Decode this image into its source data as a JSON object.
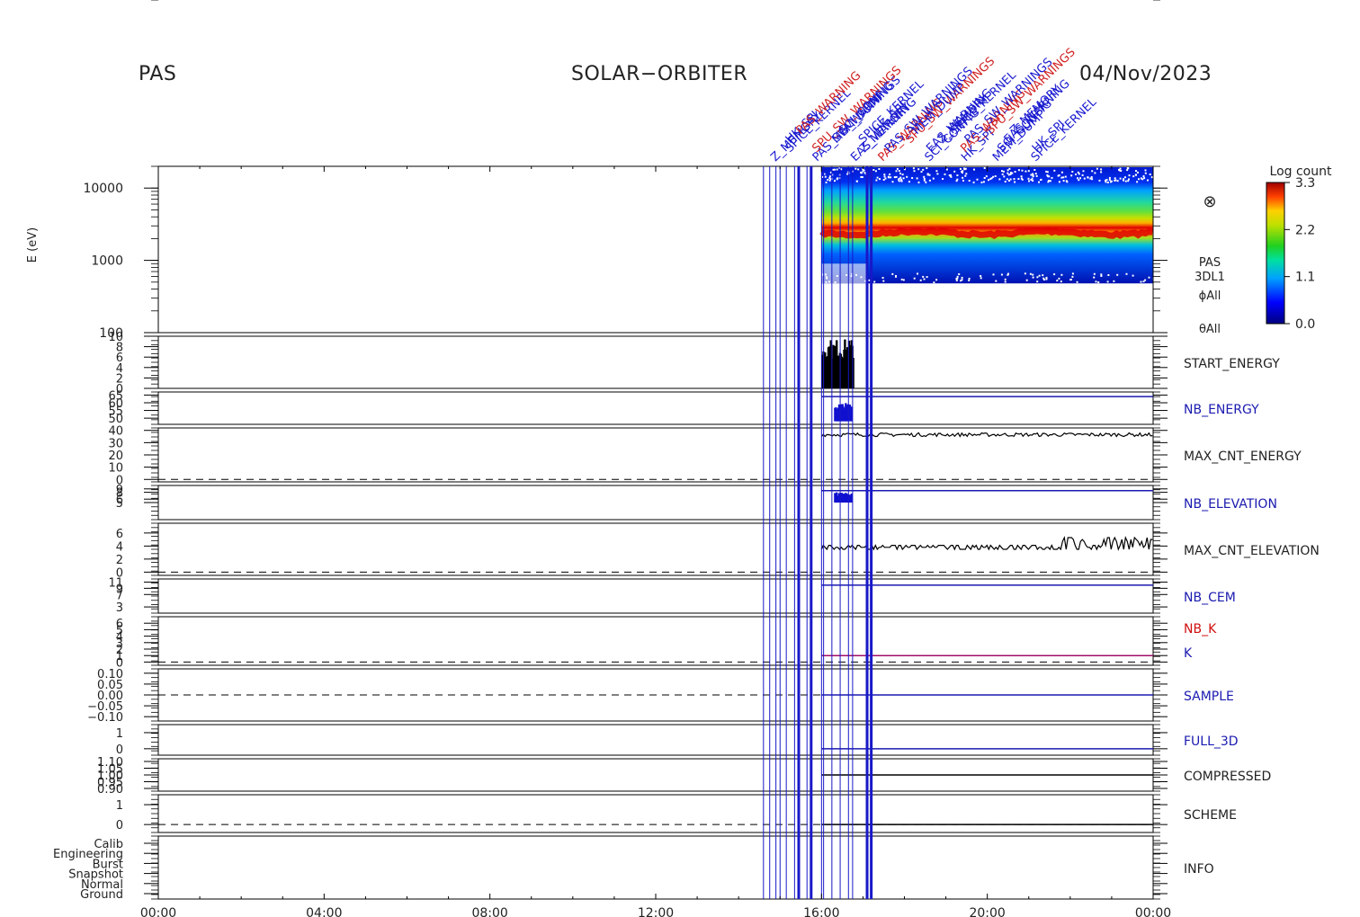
{
  "header": {
    "instrument": "PAS",
    "mission": "SOLAR−ORBITER",
    "date": "04/Nov/2023"
  },
  "colorbar": {
    "title": "Log count",
    "ticks": [
      "3.3",
      "2.2",
      "1.1",
      "0.0"
    ]
  },
  "spectrogram_labels": {
    "symbol": "⊗",
    "lines": [
      "PAS",
      "3DL1",
      "ϕAll",
      "θAll"
    ]
  },
  "event_labels": [
    "Z_MEMORY",
    "SPICE_KERNEL",
    "HK_SPI",
    "PAS_WARNING",
    "PAS_SW_WARNINGS",
    "SPU_SW_WARNINGS",
    "MEM_DUMP",
    "SCI_CONFIG",
    "EAS_WARNING"
  ],
  "chart_data": {
    "type": "heatmap",
    "x_ticks": [
      "00:00",
      "04:00",
      "08:00",
      "12:00",
      "16:00",
      "20:00",
      "00:00"
    ],
    "x_range_hours": [
      0,
      24
    ],
    "event_lines_hours": [
      14.6,
      14.75,
      14.9,
      15.0,
      15.15,
      15.35,
      15.45,
      15.65,
      15.75,
      16.0,
      16.05,
      16.25,
      16.45,
      16.65,
      16.75,
      17.1,
      17.2
    ],
    "panels": [
      {
        "name": "spectrogram",
        "ylabel": "E (eV)",
        "scale": "log",
        "ylim": [
          100,
          20000
        ],
        "y_ticks": [
          "10000",
          "1000",
          "100"
        ],
        "data_start_hour": 16.0,
        "peak_energy_ev": 2400,
        "energy_range_ev": [
          480,
          20000
        ],
        "color_range": [
          0.0,
          3.3
        ]
      },
      {
        "name": "start-energy",
        "label": "START_ENERGY",
        "label_color": "#222222",
        "y_ticks": [
          "10",
          "8",
          "6",
          "4",
          "2",
          "0"
        ],
        "ylim": [
          0,
          10
        ],
        "zero_line": true,
        "bars": {
          "color": "#000000",
          "start": 16.0,
          "end": 16.75,
          "low": 0,
          "high": 9.5
        }
      },
      {
        "name": "nb-energy",
        "label": "NB_ENERGY",
        "label_color": "#1a1ab0",
        "y_ticks": [
          "65",
          "60",
          "55",
          "50"
        ],
        "ylim": [
          46,
          67
        ],
        "bars": {
          "color": "#1010d0",
          "start": 16.3,
          "end": 16.7,
          "low": 48,
          "high": 60
        },
        "line": {
          "color": "#1a1ab0",
          "start": 16.0,
          "y": 64
        }
      },
      {
        "name": "max-cnt-energy",
        "label": "MAX_CNT_ENERGY",
        "label_color": "#222222",
        "y_ticks": [
          "40",
          "30",
          "20",
          "10",
          "0"
        ],
        "ylim": [
          -2,
          42
        ],
        "zero_line": true,
        "trace": {
          "color": "#000000",
          "start": 16.0,
          "mean": 36.5,
          "noise": 1.5
        }
      },
      {
        "name": "nb-elevation",
        "label": "NB_ELEVATION",
        "label_color": "#1a1ab0",
        "y_ticks": [
          "9",
          "8",
          "5",
          "6"
        ],
        "ylim": [
          0,
          10
        ],
        "bars": {
          "color": "#1010d0",
          "start": 16.3,
          "end": 16.7,
          "low": 5,
          "high": 8
        },
        "line": {
          "color": "#1a1ab0",
          "start": 16.0,
          "y": 8.5
        }
      },
      {
        "name": "max-cnt-elevation",
        "label": "MAX_CNT_ELEVATION",
        "label_color": "#222222",
        "y_ticks": [
          "6",
          "4",
          "2",
          "0"
        ],
        "ylim": [
          -0.5,
          7.5
        ],
        "zero_line": true,
        "trace": {
          "color": "#000000",
          "start": 16.0,
          "mean": 3.8,
          "noise": 0.8
        }
      },
      {
        "name": "nb-cem",
        "label": "NB_CEM",
        "label_color": "#1a1ab0",
        "y_ticks": [
          "11",
          "9",
          "7",
          "3"
        ],
        "ylim": [
          1,
          12
        ],
        "line": {
          "color": "#1a1ab0",
          "start": 16.0,
          "y": 10
        }
      },
      {
        "name": "nb-k-k",
        "labels": [
          {
            "text": "NB_K",
            "color": "#d01010"
          },
          {
            "text": "K",
            "color": "#1a1ab0"
          }
        ],
        "y_ticks": [
          "6",
          "5",
          "4",
          "3",
          "2",
          "1",
          "0"
        ],
        "ylim": [
          -0.5,
          7
        ],
        "zero_line": true,
        "line": {
          "color": "#a0106a",
          "start": 16.0,
          "y": 1
        }
      },
      {
        "name": "sample",
        "label": "SAMPLE",
        "label_color": "#1a1ab0",
        "y_ticks": [
          "0.10",
          "0.05",
          "0.00",
          "−0.05",
          "−0.10"
        ],
        "ylim": [
          -0.12,
          0.12
        ],
        "zero_line": true,
        "line": {
          "color": "#1a1ab0",
          "start": 16.0,
          "y": 0
        }
      },
      {
        "name": "full-3d",
        "label": "FULL_3D",
        "label_color": "#1a1ab0",
        "y_ticks": [
          "1",
          "0"
        ],
        "ylim": [
          -0.4,
          1.5
        ],
        "line": {
          "color": "#1a1ab0",
          "start": 16.0,
          "y": 0
        }
      },
      {
        "name": "compressed",
        "label": "COMPRESSED",
        "label_color": "#222222",
        "y_ticks": [
          "1.10",
          "1.05",
          "1.00",
          "0.95",
          "0.90"
        ],
        "ylim": [
          0.88,
          1.12
        ],
        "line": {
          "color": "#000000",
          "start": 16.0,
          "y": 1
        }
      },
      {
        "name": "scheme",
        "label": "SCHEME",
        "label_color": "#222222",
        "y_ticks": [
          "1",
          "0"
        ],
        "ylim": [
          -0.4,
          1.5
        ],
        "zero_line": true,
        "line": {
          "color": "#000000",
          "start": 16.0,
          "y": 0
        }
      },
      {
        "name": "info",
        "label": "INFO",
        "label_color": "#222222",
        "y_ticks": [
          "Calib",
          "Engineering",
          "Burst",
          "Snapshot",
          "Normal",
          "Ground"
        ],
        "ylim": [
          0,
          6
        ]
      }
    ]
  }
}
